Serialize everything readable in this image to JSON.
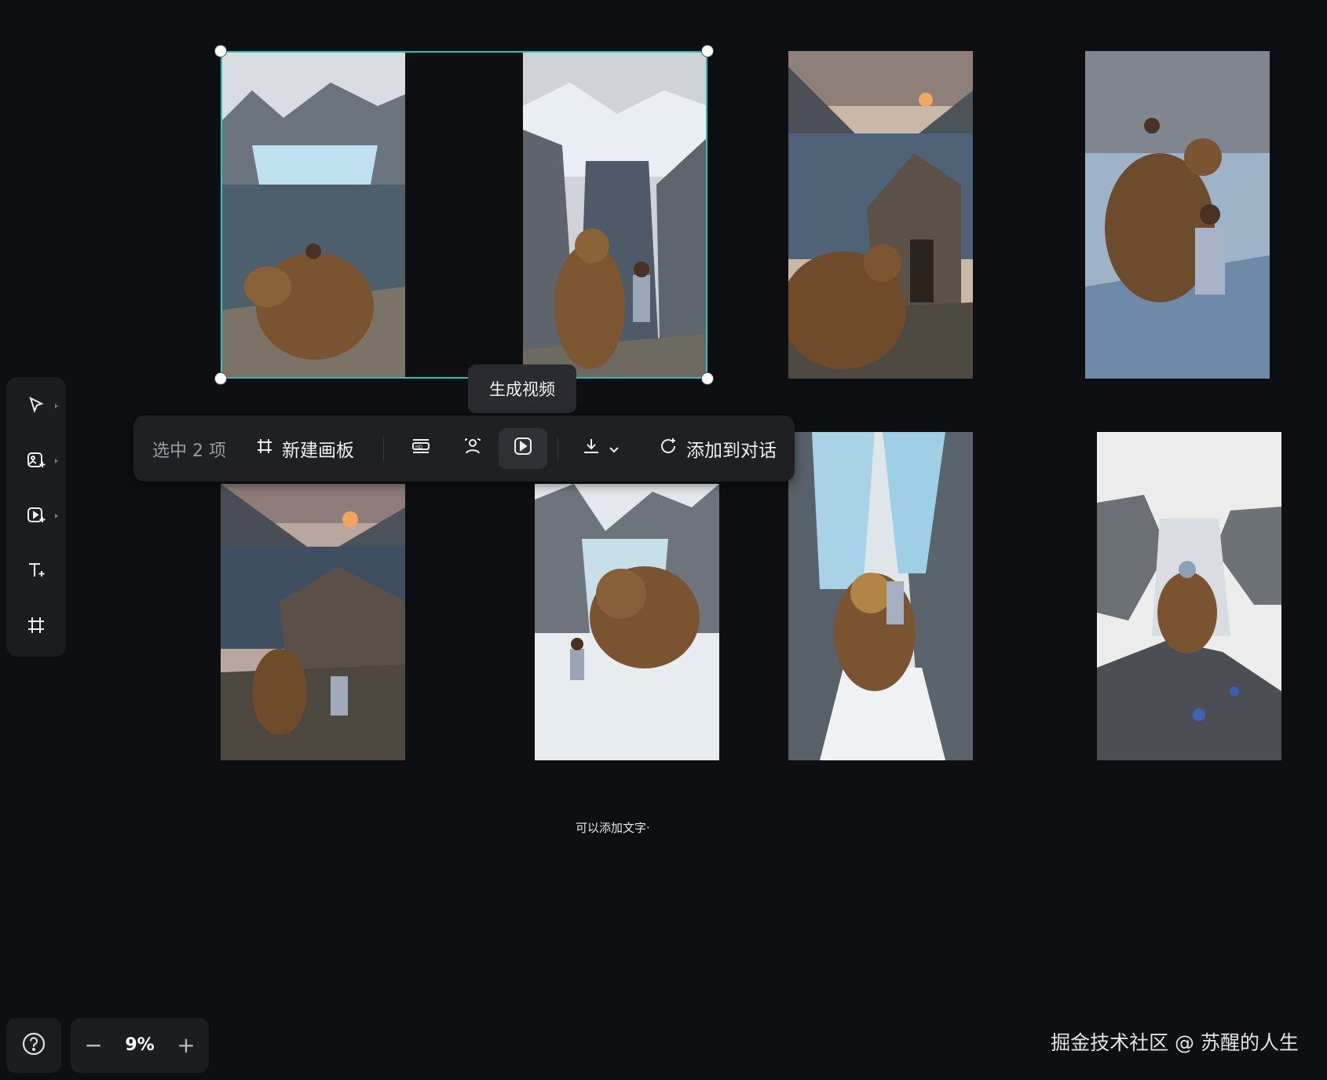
{
  "selection_toolbar": {
    "selected_label": "选中 2 项",
    "new_board_label": "新建画板",
    "hd_icon": "hd-upscale-icon",
    "portrait_icon": "person-cutout-icon",
    "video_icon": "generate-video-icon",
    "download_icon": "download-icon",
    "add_to_chat_label": "添加到对话"
  },
  "tooltip": {
    "text": "生成视频"
  },
  "canvas": {
    "caption": "可以添加文字·",
    "images": [
      {
        "name": "image-bear-glacier-lake",
        "scene": "bear and girl by glacier lake"
      },
      {
        "name": "image-bear-fjord-cliff",
        "scene": "bear and girl on fjord cliff"
      },
      {
        "name": "image-bear-cabin-sunset",
        "scene": "bear at cabin at sunset"
      },
      {
        "name": "image-bear-frozen-lake",
        "scene": "bear carrying child on frozen lake"
      },
      {
        "name": "image-cabin-sunset-bear",
        "scene": "cabin and bear by lake"
      },
      {
        "name": "image-bear-ice-field",
        "scene": "bear on ice field"
      },
      {
        "name": "image-bear-ice-canyon",
        "scene": "bear in ice canyon"
      },
      {
        "name": "image-bear-mountain-fjord",
        "scene": "bear on rocky peak over fjord"
      }
    ]
  },
  "left_toolbar": {
    "tools": [
      "select-tool-icon",
      "add-image-icon",
      "add-video-icon",
      "add-text-icon",
      "artboard-icon"
    ]
  },
  "zoom": {
    "value": "9%",
    "minus": "−",
    "plus": "+"
  },
  "watermark": "掘金技术社区 @ 苏醒的人生",
  "colors": {
    "selection": "#20c2c2",
    "background": "#0e0f12",
    "panel": "#1f2024"
  }
}
